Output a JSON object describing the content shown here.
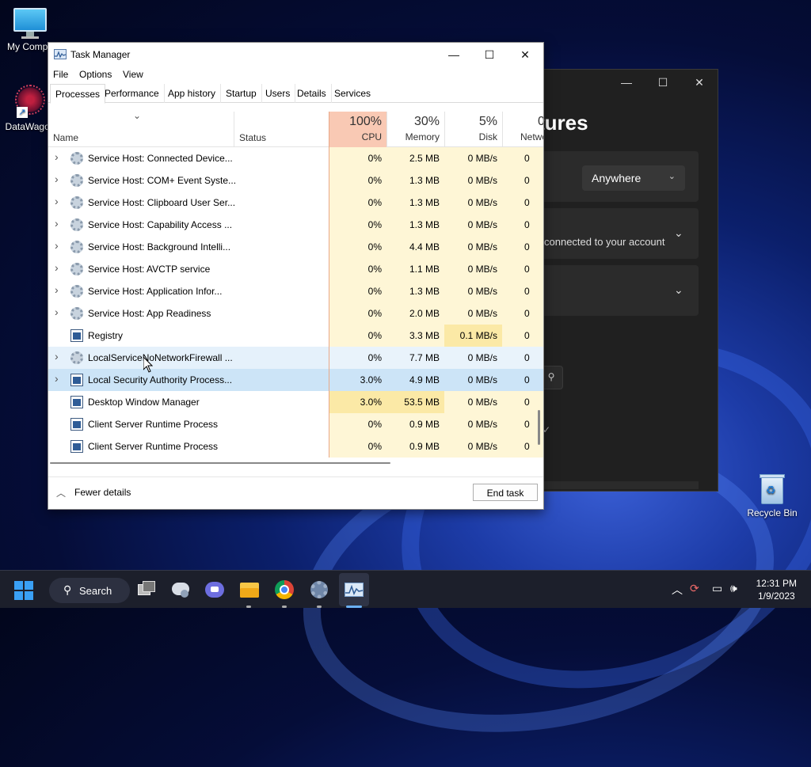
{
  "desktop": {
    "icons": [
      {
        "label": "My Compu"
      },
      {
        "label": "DataWagon"
      },
      {
        "label": "Recycle Bin"
      }
    ]
  },
  "settings_window": {
    "title_fragment": "tures",
    "dropdown_value": "Anywhere",
    "card_text": "connected to your account"
  },
  "task_manager": {
    "title": "Task Manager",
    "menu": [
      "File",
      "Options",
      "View"
    ],
    "tabs": [
      "Processes",
      "Performance",
      "App history",
      "Startup",
      "Users",
      "Details",
      "Services"
    ],
    "columns": {
      "name": "Name",
      "status": "Status",
      "cpu": {
        "pct": "100%",
        "label": "CPU"
      },
      "memory": {
        "pct": "30%",
        "label": "Memory"
      },
      "disk": {
        "pct": "5%",
        "label": "Disk"
      },
      "network": {
        "pct": "0",
        "label": "Netwo"
      }
    },
    "rows": [
      {
        "name": "Service Host: Connected Device...",
        "cpu": "0%",
        "memory": "2.5 MB",
        "disk": "0 MB/s",
        "network": "0",
        "expandable": true,
        "icon": "gear"
      },
      {
        "name": "Service Host: COM+ Event Syste...",
        "cpu": "0%",
        "memory": "1.3 MB",
        "disk": "0 MB/s",
        "network": "0",
        "expandable": true,
        "icon": "gear"
      },
      {
        "name": "Service Host: Clipboard User Ser...",
        "cpu": "0%",
        "memory": "1.3 MB",
        "disk": "0 MB/s",
        "network": "0",
        "expandable": true,
        "icon": "gear"
      },
      {
        "name": "Service Host: Capability Access ...",
        "cpu": "0%",
        "memory": "1.3 MB",
        "disk": "0 MB/s",
        "network": "0",
        "expandable": true,
        "icon": "gear"
      },
      {
        "name": "Service Host: Background Intelli...",
        "cpu": "0%",
        "memory": "4.4 MB",
        "disk": "0 MB/s",
        "network": "0",
        "expandable": true,
        "icon": "gear"
      },
      {
        "name": "Service Host: AVCTP service",
        "cpu": "0%",
        "memory": "1.1 MB",
        "disk": "0 MB/s",
        "network": "0",
        "expandable": true,
        "icon": "gear"
      },
      {
        "name": "Service Host: Application Infor...",
        "cpu": "0%",
        "memory": "1.3 MB",
        "disk": "0 MB/s",
        "network": "0",
        "expandable": true,
        "icon": "gear"
      },
      {
        "name": "Service Host: App Readiness",
        "cpu": "0%",
        "memory": "2.0 MB",
        "disk": "0 MB/s",
        "network": "0",
        "expandable": true,
        "icon": "gear"
      },
      {
        "name": "Registry",
        "cpu": "0%",
        "memory": "3.3 MB",
        "disk": "0.1 MB/s",
        "network": "0",
        "expandable": false,
        "icon": "frame"
      },
      {
        "name": "LocalServiceNoNetworkFirewall ...",
        "cpu": "0%",
        "memory": "7.7 MB",
        "disk": "0 MB/s",
        "network": "0",
        "expandable": true,
        "icon": "gear",
        "state": "hover"
      },
      {
        "name": "Local Security Authority Process...",
        "cpu": "3.0%",
        "memory": "4.9 MB",
        "disk": "0 MB/s",
        "network": "0",
        "expandable": true,
        "icon": "frame",
        "state": "selected"
      },
      {
        "name": "Desktop Window Manager",
        "cpu": "3.0%",
        "memory": "53.5 MB",
        "disk": "0 MB/s",
        "network": "0",
        "expandable": false,
        "icon": "frame"
      },
      {
        "name": "Client Server Runtime Process",
        "cpu": "0%",
        "memory": "0.9 MB",
        "disk": "0 MB/s",
        "network": "0",
        "expandable": false,
        "icon": "frame"
      },
      {
        "name": "Client Server Runtime Process",
        "cpu": "0%",
        "memory": "0.9 MB",
        "disk": "0 MB/s",
        "network": "0",
        "expandable": false,
        "icon": "frame"
      }
    ],
    "footer": {
      "fewer_details": "Fewer details",
      "end_task": "End task"
    }
  },
  "taskbar": {
    "search_label": "Search",
    "time": "12:31 PM",
    "date": "1/9/2023"
  },
  "colors": {
    "cpu_header": "#f9c9b4",
    "cpu_col": "#fdf0c5",
    "heat_light": "#fef6d6",
    "heat_mid": "#fbe9a6",
    "hover": "#e5f1fb",
    "selected": "#cce4f7"
  }
}
